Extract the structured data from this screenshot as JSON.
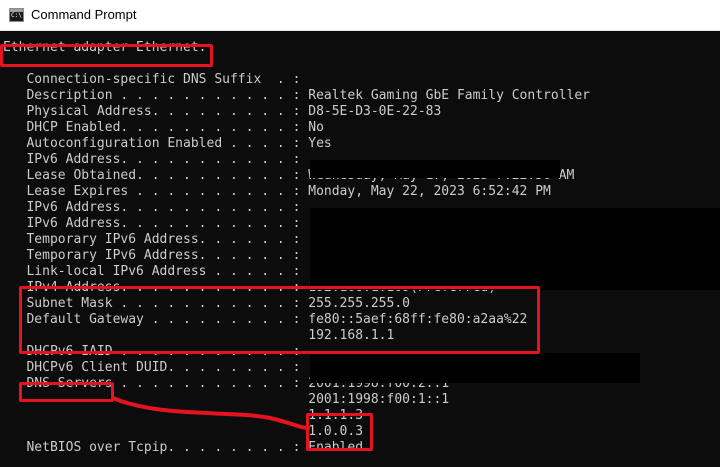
{
  "window": {
    "title": "Command Prompt",
    "icon": "cmd-icon",
    "console_bg": "#0c0c0c",
    "console_fg": "#cccccc",
    "highlight_color": "#e5131f"
  },
  "console": {
    "lines": [
      {
        "text": "Ethernet adapter Ethernet:"
      },
      {
        "text": ""
      },
      {
        "text": "   Connection-specific DNS Suffix  . :"
      },
      {
        "text": "   Description . . . . . . . . . . . : Realtek Gaming GbE Family Controller"
      },
      {
        "text": "   Physical Address. . . . . . . . . : D8-5E-D3-0E-22-83"
      },
      {
        "text": "   DHCP Enabled. . . . . . . . . . . : No"
      },
      {
        "text": "   Autoconfiguration Enabled . . . . : Yes"
      },
      {
        "text": "   IPv6 Address. . . . . . . . . . . :"
      },
      {
        "text": "   Lease Obtained. . . . . . . . . . : Wednesday, May 17, 2023 7:22:56 AM"
      },
      {
        "text": "   Lease Expires . . . . . . . . . . : Monday, May 22, 2023 6:52:42 PM"
      },
      {
        "text": "   IPv6 Address. . . . . . . . . . . :"
      },
      {
        "text": "   IPv6 Address. . . . . . . . . . . :"
      },
      {
        "text": "   Temporary IPv6 Address. . . . . . :"
      },
      {
        "text": "   Temporary IPv6 Address. . . . . . :"
      },
      {
        "text": "   Link-local IPv6 Address . . . . . :"
      },
      {
        "text": "   IPv4 Address. . . . . . . . . . . : 192.168.1.109(Preferred)"
      },
      {
        "text": "   Subnet Mask . . . . . . . . . . . : 255.255.255.0"
      },
      {
        "text": "   Default Gateway . . . . . . . . . : fe80::5aef:68ff:fe80:a2aa%22"
      },
      {
        "text": "                                       192.168.1.1"
      },
      {
        "text": "   DHCPv6 IAID . . . . . . . . . . . :"
      },
      {
        "text": "   DHCPv6 Client DUID. . . . . . . . :"
      },
      {
        "text": "   DNS Servers . . . . . . . . . . . : 2001:1998:f00:2::1"
      },
      {
        "text": "                                       2001:1998:f00:1::1"
      },
      {
        "text": "                                       1.1.1.3"
      },
      {
        "text": "                                       1.0.0.3"
      },
      {
        "text": "   NetBIOS over Tcpip. . . . . . . . : Enabled"
      }
    ]
  }
}
